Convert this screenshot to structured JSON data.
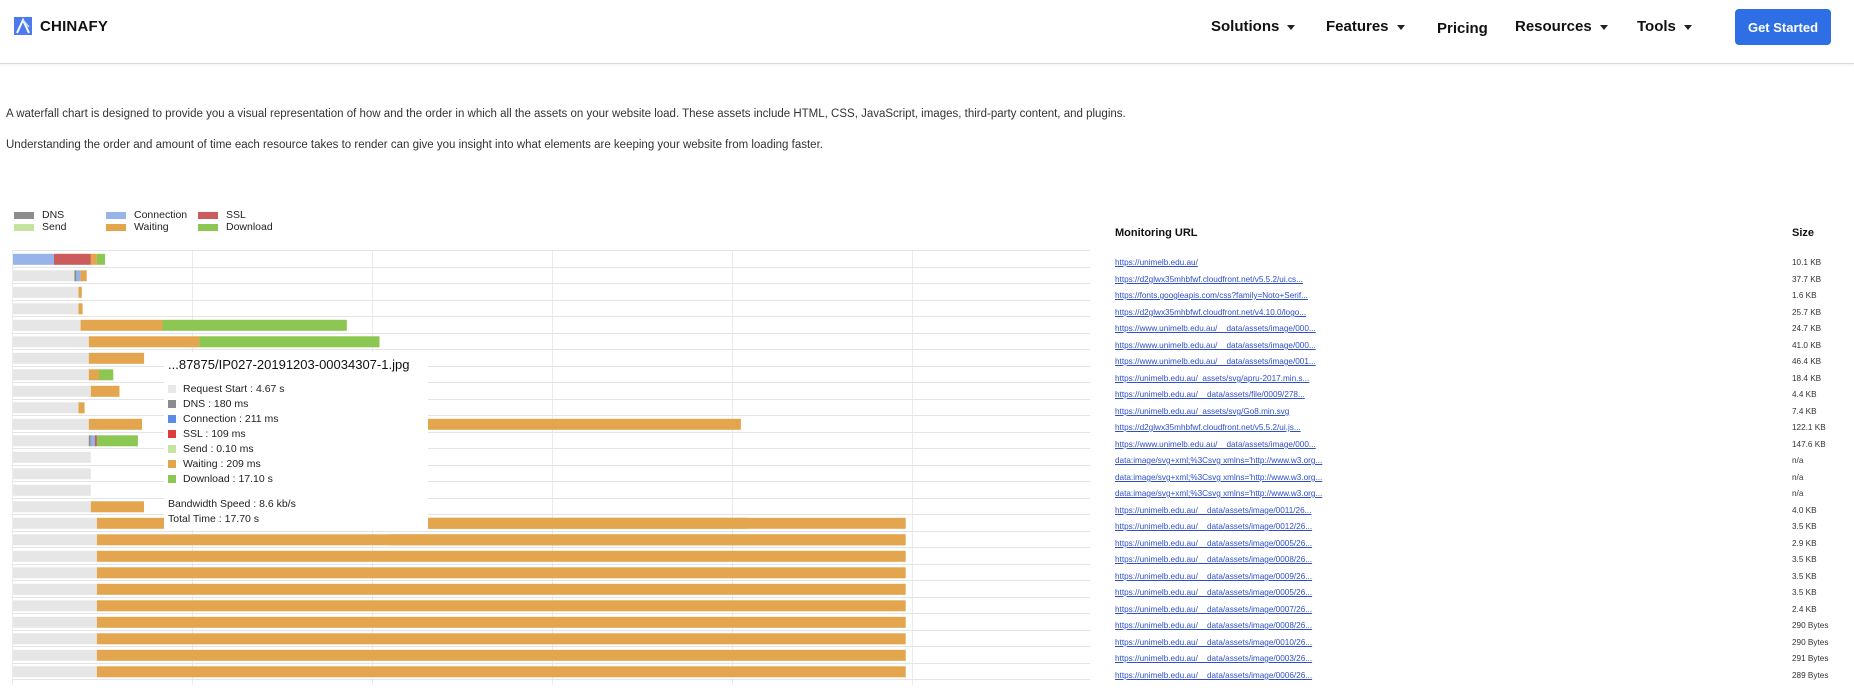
{
  "header": {
    "brand": "CHINAFY",
    "nav": [
      {
        "label": "Solutions",
        "dropdown": true
      },
      {
        "label": "Features",
        "dropdown": true
      },
      {
        "label": "Pricing",
        "dropdown": false
      },
      {
        "label": "Resources",
        "dropdown": true
      },
      {
        "label": "Tools",
        "dropdown": true
      }
    ],
    "cta_label": "Get Started",
    "accent": "#2f6fe6"
  },
  "intro": {
    "p1": "A waterfall chart is designed to provide you a visual representation of how and the order in which all the assets on your website load. These assets include HTML, CSS, JavaScript, images, third-party content, and plugins.",
    "p2": "Understanding the order and amount of time each resource takes to render can give you insight into what elements are keeping your website from loading faster."
  },
  "legend": [
    {
      "label": "DNS",
      "color": "#8c8c8c"
    },
    {
      "label": "Connection",
      "color": "#97b4e8"
    },
    {
      "label": "SSL",
      "color": "#cc5c5c"
    },
    {
      "label": "Send",
      "color": "#c7e3a0"
    },
    {
      "label": "Waiting",
      "color": "#e3a64f"
    },
    {
      "label": "Download",
      "color": "#8cc653"
    }
  ],
  "tooltip": {
    "title": "...87875/IP027-20191203-00034307-1.jpg",
    "lines": [
      {
        "label": "Request Start : 4.67 s",
        "color": "#e8e8e8"
      },
      {
        "label": "DNS : 180 ms",
        "color": "#8c8c8c"
      },
      {
        "label": "Connection : 211 ms",
        "color": "#5b8de8"
      },
      {
        "label": "SSL : 109 ms",
        "color": "#dd3c3c"
      },
      {
        "label": "Send : 0.10 ms",
        "color": "#c7e3a0"
      },
      {
        "label": "Waiting : 209 ms",
        "color": "#e3a64f"
      },
      {
        "label": "Download : 17.10 s",
        "color": "#8cc653"
      }
    ],
    "bandwidth": "Bandwidth Speed : 8.6 kb/s",
    "total": "Total Time : 17.70 s"
  },
  "table": {
    "url_header": "Monitoring URL",
    "size_header": "Size",
    "rows": [
      {
        "url": "https://unimelb.edu.au/",
        "size": "10.1 KB"
      },
      {
        "url": "https://d2glwx35mhbfwf.cloudfront.net/v5.5.2/ui.cs...",
        "size": "37.7 KB"
      },
      {
        "url": "https://fonts.googleapis.com/css?family=Noto+Serif...",
        "size": "1.6 KB"
      },
      {
        "url": "https://d2glwx35mhbfwf.cloudfront.net/v4.10.0/logo...",
        "size": "25.7 KB"
      },
      {
        "url": "https://www.unimelb.edu.au/__data/assets/image/000...",
        "size": "24.7 KB"
      },
      {
        "url": "https://www.unimelb.edu.au/__data/assets/image/000...",
        "size": "41.0 KB"
      },
      {
        "url": "https://www.unimelb.edu.au/__data/assets/image/001...",
        "size": "46.4 KB"
      },
      {
        "url": "https://unimelb.edu.au/_assets/svg/apru-2017.min.s...",
        "size": "18.4 KB"
      },
      {
        "url": "https://unimelb.edu.au/__data/assets/file/0009/278...",
        "size": "4.4 KB"
      },
      {
        "url": "https://unimelb.edu.au/_assets/svg/Go8.min.svg",
        "size": "7.4 KB"
      },
      {
        "url": "https://d2glwx35mhbfwf.cloudfront.net/v5.5.2/ui.js...",
        "size": "122.1 KB"
      },
      {
        "url": "https://www.unimelb.edu.au/__data/assets/image/000...",
        "size": "147.6 KB"
      },
      {
        "url": "data:image/svg+xml;%3Csvg xmlns='http://www.w3.org...",
        "size": "n/a"
      },
      {
        "url": "data:image/svg+xml;%3Csvg xmlns='http://www.w3.org...",
        "size": "n/a"
      },
      {
        "url": "data:image/svg+xml;%3Csvg xmlns='http://www.w3.org...",
        "size": "n/a"
      },
      {
        "url": "https://unimelb.edu.au/__data/assets/image/0011/26...",
        "size": "4.0 KB"
      },
      {
        "url": "https://unimelb.edu.au/__data/assets/image/0012/26...",
        "size": "3.5 KB"
      },
      {
        "url": "https://unimelb.edu.au/__data/assets/image/0005/26...",
        "size": "2.9 KB"
      },
      {
        "url": "https://unimelb.edu.au/__data/assets/image/0008/26...",
        "size": "3.5 KB"
      },
      {
        "url": "https://unimelb.edu.au/__data/assets/image/0009/26...",
        "size": "3.5 KB"
      },
      {
        "url": "https://unimelb.edu.au/__data/assets/image/0005/26...",
        "size": "3.5 KB"
      },
      {
        "url": "https://unimelb.edu.au/__data/assets/image/0007/26...",
        "size": "2.4 KB"
      },
      {
        "url": "https://unimelb.edu.au/__data/assets/image/0008/26...",
        "size": "290 Bytes"
      },
      {
        "url": "https://unimelb.edu.au/__data/assets/image/0010/26...",
        "size": "290 Bytes"
      },
      {
        "url": "https://unimelb.edu.au/__data/assets/image/0003/26...",
        "size": "291 Bytes"
      },
      {
        "url": "https://unimelb.edu.au/__data/assets/image/0006/26...",
        "size": "289 Bytes"
      }
    ]
  },
  "chart_data": {
    "type": "bar",
    "orientation": "horizontal-stacked",
    "phases": [
      "request_start",
      "dns",
      "connection",
      "ssl",
      "send",
      "waiting",
      "download"
    ],
    "phase_colors": {
      "request_start": "#e6e6e6",
      "dns": "#8c8c8c",
      "connection": "#97b4e8",
      "ssl": "#cc5c5c",
      "send": "#c7e3a0",
      "waiting": "#e3a64f",
      "download": "#8cc653"
    },
    "x_max_s": 24.0,
    "grid": true,
    "rows": [
      {
        "request_start": 0.0,
        "dns": 0.0,
        "connection": 1.0,
        "ssl": 0.9,
        "send": 0.0,
        "waiting": 0.15,
        "download": 0.2
      },
      {
        "request_start": 1.5,
        "dns": 0.05,
        "connection": 0.1,
        "ssl": 0.0,
        "send": 0.0,
        "waiting": 0.15,
        "download": 0.0
      },
      {
        "request_start": 1.6,
        "dns": 0.0,
        "connection": 0.0,
        "ssl": 0.0,
        "send": 0.0,
        "waiting": 0.08,
        "download": 0.0
      },
      {
        "request_start": 1.6,
        "dns": 0.0,
        "connection": 0.0,
        "ssl": 0.0,
        "send": 0.0,
        "waiting": 0.1,
        "download": 0.0
      },
      {
        "request_start": 1.65,
        "dns": 0.0,
        "connection": 0.0,
        "ssl": 0.0,
        "send": 0.0,
        "waiting": 2.0,
        "download": 4.5
      },
      {
        "request_start": 1.85,
        "dns": 0.0,
        "connection": 0.0,
        "ssl": 0.0,
        "send": 0.0,
        "waiting": 2.7,
        "download": 4.4
      },
      {
        "request_start": 1.85,
        "dns": 0.0,
        "connection": 0.0,
        "ssl": 0.0,
        "send": 0.0,
        "waiting": 1.35,
        "download": 0.0
      },
      {
        "request_start": 1.85,
        "dns": 0.0,
        "connection": 0.0,
        "ssl": 0.0,
        "send": 0.0,
        "waiting": 0.25,
        "download": 0.35
      },
      {
        "request_start": 1.9,
        "dns": 0.0,
        "connection": 0.0,
        "ssl": 0.0,
        "send": 0.0,
        "waiting": 0.7,
        "download": 0.0
      },
      {
        "request_start": 1.6,
        "dns": 0.0,
        "connection": 0.0,
        "ssl": 0.0,
        "send": 0.0,
        "waiting": 0.15,
        "download": 0.0
      },
      {
        "request_start": 1.85,
        "dns": 0.0,
        "connection": 0.0,
        "ssl": 0.0,
        "send": 0.0,
        "waiting": 1.3,
        "download": 0.0
      },
      {
        "request_start": 1.85,
        "dns": 0.05,
        "connection": 0.1,
        "ssl": 0.05,
        "send": 0.0,
        "waiting": 0.0,
        "download": 1.0
      },
      {
        "request_start": 1.9,
        "dns": 0.0,
        "connection": 0.0,
        "ssl": 0.0,
        "send": 0.0,
        "waiting": 0.0,
        "download": 0.0
      },
      {
        "request_start": 1.9,
        "dns": 0.0,
        "connection": 0.0,
        "ssl": 0.0,
        "send": 0.0,
        "waiting": 0.0,
        "download": 0.0
      },
      {
        "request_start": 1.9,
        "dns": 0.0,
        "connection": 0.0,
        "ssl": 0.0,
        "send": 0.0,
        "waiting": 0.0,
        "download": 0.0
      },
      {
        "request_start": 1.9,
        "dns": 0.0,
        "connection": 0.0,
        "ssl": 0.0,
        "send": 0.0,
        "waiting": 1.3,
        "download": 0.0
      },
      {
        "request_start": 2.05,
        "dns": 0.0,
        "connection": 0.0,
        "ssl": 0.0,
        "send": 0.0,
        "waiting": 19.75,
        "download": 0.0
      },
      {
        "request_start": 2.05,
        "dns": 0.0,
        "connection": 0.0,
        "ssl": 0.0,
        "send": 0.0,
        "waiting": 19.75,
        "download": 0.0
      },
      {
        "request_start": 2.05,
        "dns": 0.0,
        "connection": 0.0,
        "ssl": 0.0,
        "send": 0.0,
        "waiting": 19.75,
        "download": 0.0
      },
      {
        "request_start": 2.05,
        "dns": 0.0,
        "connection": 0.0,
        "ssl": 0.0,
        "send": 0.0,
        "waiting": 19.75,
        "download": 0.0
      },
      {
        "request_start": 2.05,
        "dns": 0.0,
        "connection": 0.0,
        "ssl": 0.0,
        "send": 0.0,
        "waiting": 19.75,
        "download": 0.0
      },
      {
        "request_start": 2.05,
        "dns": 0.0,
        "connection": 0.0,
        "ssl": 0.0,
        "send": 0.0,
        "waiting": 19.75,
        "download": 0.0
      },
      {
        "request_start": 2.05,
        "dns": 0.0,
        "connection": 0.0,
        "ssl": 0.0,
        "send": 0.0,
        "waiting": 19.75,
        "download": 0.0
      },
      {
        "request_start": 2.05,
        "dns": 0.0,
        "connection": 0.0,
        "ssl": 0.0,
        "send": 0.0,
        "waiting": 19.75,
        "download": 0.0
      },
      {
        "request_start": 2.05,
        "dns": 0.0,
        "connection": 0.0,
        "ssl": 0.0,
        "send": 0.0,
        "waiting": 19.75,
        "download": 0.0
      },
      {
        "request_start": 2.05,
        "dns": 0.0,
        "connection": 0.0,
        "ssl": 0.0,
        "send": 0.0,
        "waiting": 19.75,
        "download": 0.0
      }
    ],
    "overflow_bars": [
      {
        "row": 7,
        "phase": "download",
        "start_s": 9.2,
        "duration_s": 0.25
      },
      {
        "row": 10,
        "phase": "waiting",
        "start_s": 9.2,
        "duration_s": 8.6
      },
      {
        "row": 16,
        "phase": "waiting",
        "start_s": 9.2,
        "duration_s": 8.75
      },
      {
        "row": 17,
        "phase": "waiting",
        "start_s": 9.2,
        "duration_s": 12.6
      }
    ]
  }
}
